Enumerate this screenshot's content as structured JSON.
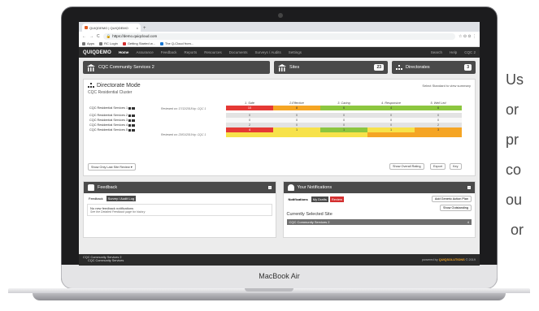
{
  "laptop": {
    "model_label": "MacBook Air"
  },
  "side_text": [
    "Us",
    "or",
    "pr",
    "co",
    "ou",
    "or"
  ],
  "browser": {
    "tab_title": "QUIQDEMO | QUIQDEMO",
    "tab_close": "×",
    "new_tab": "+",
    "url": "https://demo.quiqcloud.com",
    "nav": [
      "←",
      "→",
      "C"
    ],
    "toolbar_icons": "☆  ⊙  ⊙  ⋮",
    "bookmarks": [
      "Apps",
      "RC Login",
      "Getting Started w...",
      "The Q-Cloud from..."
    ]
  },
  "app": {
    "brand": "QUIQDEMO",
    "nav": [
      "Home",
      "Assurance",
      "Feedback",
      "Reports",
      "Resources",
      "Documents",
      "Surveys / Audits",
      "Settings"
    ],
    "nav_right": [
      "Search",
      "Help",
      "CQC 2"
    ]
  },
  "panels": {
    "main_title": "CQC Community Services 2",
    "sites_title": "Sites",
    "sites_count": "23",
    "directorates_title": "Directorates",
    "directorates_count": "3"
  },
  "directorate": {
    "title": "Directorate Mode",
    "subtitle": "CQC Residential Cluster",
    "hint": "Select Standard to view summary",
    "columns": [
      "1. Safe",
      "2.Effective",
      "3. Caring",
      "4. Responsive",
      "5. Well Led"
    ],
    "rows": [
      {
        "label": "CQC Residential Services 1",
        "values": [
          "10",
          "8",
          "6",
          "4",
          "6"
        ],
        "review": "Reviewed on: 17/12/2018 by: CQC 1"
      },
      {
        "label": "CQC Residential Services 2",
        "values": [
          "0",
          "0",
          "0",
          "0",
          "0"
        ],
        "review": ""
      },
      {
        "label": "CQC Residential Services 3",
        "values": [
          "0",
          "0",
          "0",
          "0",
          "0"
        ],
        "review": ""
      },
      {
        "label": "CQC Residential Services 4",
        "values": [
          "2",
          "0",
          "0",
          "0",
          "2"
        ],
        "review": ""
      },
      {
        "label": "CQC Residential Services 5",
        "values": [
          "4",
          "1",
          "1",
          "1",
          "3"
        ],
        "review": "Reviewed on: 23/01/2019 by: CQC 1"
      }
    ],
    "btn_last_review": "Show Only Last Site Review ▾",
    "btn_overall": "Show Overall Rating",
    "btn_export": "Export",
    "btn_key": "Key"
  },
  "feedback": {
    "title": "Feedback",
    "tabs": [
      "Feedback",
      "Survey / Audit Log"
    ],
    "message": "No new feedback notifications",
    "note": "See the Detailed Feedback page for history"
  },
  "notifications": {
    "title": "Your Notifications",
    "tabs": [
      "Notifications",
      "My Drafts",
      "Review"
    ],
    "add_btn": "Add Generic Action Plan",
    "show_btn": "Show Outstanding",
    "heading": "Currently Selected Site",
    "site": "CQC Community Services 2",
    "site_count": "4"
  },
  "footer": {
    "line1": "CQC Community Services 2",
    "line2": "CQC Community Services",
    "right_prefix": "powered by",
    "right_brand": "QUIQSOLUTIONS",
    "right_year": "© 2019"
  }
}
